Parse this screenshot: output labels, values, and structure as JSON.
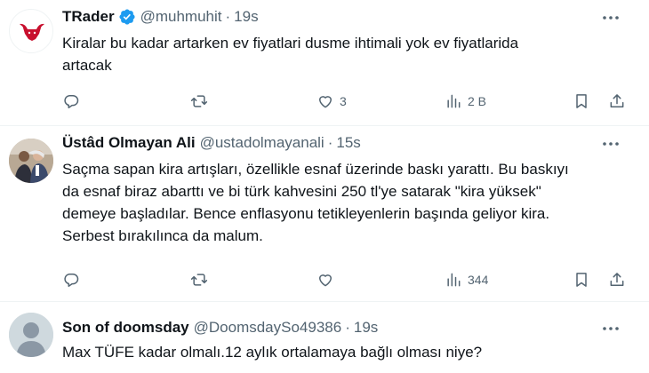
{
  "tweets": [
    {
      "name": "TRader",
      "verified": true,
      "handle": "@muhmuhit",
      "separator": "·",
      "time": "19s",
      "text_lines": [
        "Kiralar bu kadar artarken ev fiyatlari dusme ihtimali yok ev fiyatlarida",
        "artacak"
      ],
      "likes": "3",
      "views": "2 B",
      "avatar_icon": "trader-bull-logo"
    },
    {
      "name": "Üstâd Olmayan Ali",
      "verified": false,
      "handle": "@ustadolmayanali",
      "separator": "·",
      "time": "15s",
      "text_lines": [
        "Saçma sapan kira artışları, özellikle esnaf üzerinde baskı yarattı. Bu baskıyı",
        "da esnaf biraz abarttı ve bi türk kahvesini 250 tl'ye satarak \"kira yüksek\"",
        "demeye başladılar. Bence enflasyonu tetikleyenlerin başında geliyor kira.",
        "Serbest bırakılınca da malum."
      ],
      "likes": "",
      "views": "344",
      "avatar_icon": "group-photo"
    },
    {
      "name": "Son of doomsday",
      "verified": false,
      "handle": "@DoomsdaySo49386",
      "separator": "·",
      "time": "19s",
      "text_lines": [
        "Max TÜFE kadar olmalı.12 aylık ortalamaya bağlı olması niye?"
      ],
      "avatar_icon": "default-avatar"
    }
  ],
  "colors": {
    "text": "#0f1419",
    "secondary": "#536471",
    "verified": "#1d9bf0",
    "divider": "#eff3f4",
    "brand_red": "#c8102e"
  }
}
